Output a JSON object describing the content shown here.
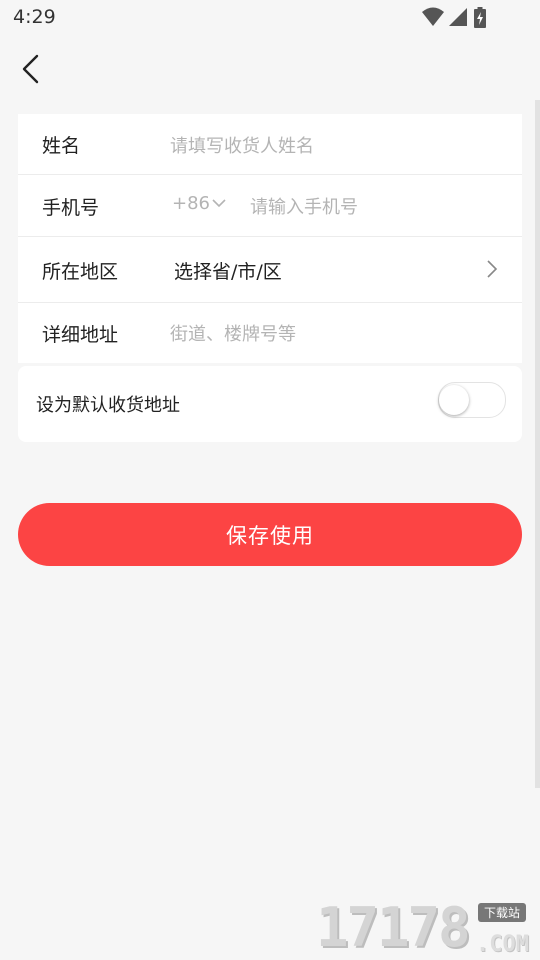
{
  "status_bar": {
    "time": "4:29",
    "icons": [
      "wifi-icon",
      "cellular-signal-icon",
      "battery-charging-icon"
    ]
  },
  "nav": {
    "back_icon": "chevron-left-icon"
  },
  "form": {
    "name": {
      "label": "姓名",
      "placeholder": "请填写收货人姓名"
    },
    "phone": {
      "label": "手机号",
      "country_code": "+86",
      "placeholder": "请输入手机号"
    },
    "region": {
      "label": "所在地区",
      "value": "选择省/市/区"
    },
    "address": {
      "label": "详细地址",
      "placeholder": "街道、楼牌号等"
    }
  },
  "default_address": {
    "label": "设为默认收货地址",
    "enabled": false
  },
  "actions": {
    "save_label": "保存使用"
  },
  "watermark": {
    "number": "17178",
    "tag": "下载站",
    "domain": ".COM"
  },
  "colors": {
    "accent": "#fc4444",
    "background": "#f6f6f6",
    "card": "#ffffff",
    "placeholder": "#b4b4b4"
  }
}
